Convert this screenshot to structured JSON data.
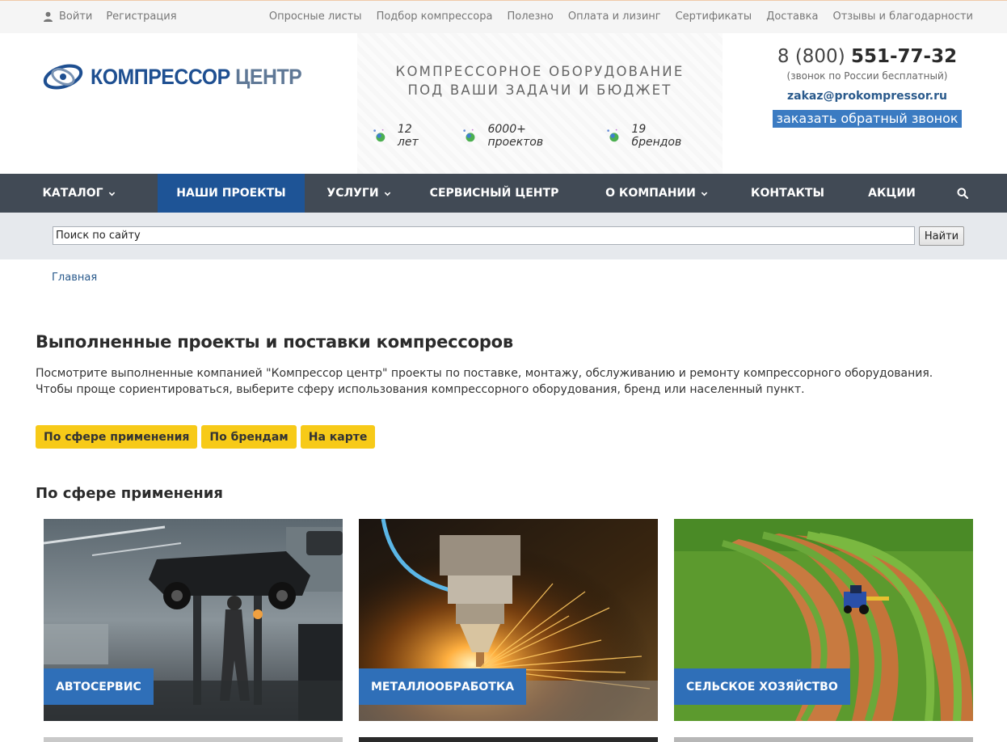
{
  "topbar": {
    "login": "Войти",
    "register": "Регистрация",
    "links": [
      "Опросные листы",
      "Подбор компрессора",
      "Полезно",
      "Оплата и лизинг",
      "Сертификаты",
      "Доставка",
      "Отзывы и благодарности"
    ]
  },
  "logo": {
    "part1": "КОМПРЕССОР",
    "part2": "ЦЕНТР"
  },
  "banner": {
    "line1": "КОМПРЕССОРНОЕ ОБОРУДОВАНИЕ",
    "line2": "ПОД ВАШИ ЗАДАЧИ И БЮДЖЕТ",
    "stats": [
      "12 лет",
      "6000+ проектов",
      "19 брендов"
    ]
  },
  "contacts": {
    "phone_prefix": "8 (800)",
    "phone_number": "551-77-32",
    "phone_note": "(звонок по России бесплатный)",
    "email": "zakaz@prokompressor.ru",
    "callback": "заказать обратный звонок"
  },
  "nav": {
    "items": [
      "КАТАЛОГ",
      "НАШИ ПРОЕКТЫ",
      "УСЛУГИ",
      "СЕРВИСНЫЙ ЦЕНТР",
      "О КОМПАНИИ",
      "КОНТАКТЫ",
      "АКЦИИ"
    ],
    "active": "НАШИ ПРОЕКТЫ"
  },
  "search": {
    "value": "Поиск по сайту",
    "button": "Найти"
  },
  "breadcrumb": "Главная",
  "page": {
    "title": "Выполненные проекты и поставки компрессоров",
    "intro1": "Посмотрите выполненные компанией \"Компрессор центр\" проекты по поставке, монтажу, обслуживанию и ремонту компрессорного оборудования.",
    "intro2": "Чтобы проще сориентироваться, выберите сферу использования компрессорного оборудования, бренд или населенный пункт.",
    "filters": [
      "По сфере применения",
      "По брендам",
      "На карте"
    ],
    "section_title": "По сфере применения"
  },
  "cards": [
    "АВТОСЕРВИС",
    "МЕТАЛЛООБРАБОТКА",
    "СЕЛЬСКОЕ ХОЗЯЙСТВО"
  ],
  "colors": {
    "nav_bg": "#414a55",
    "nav_active": "#1e5496",
    "accent_blue": "#2f6fb8",
    "filter_yellow": "#f7ca18"
  }
}
